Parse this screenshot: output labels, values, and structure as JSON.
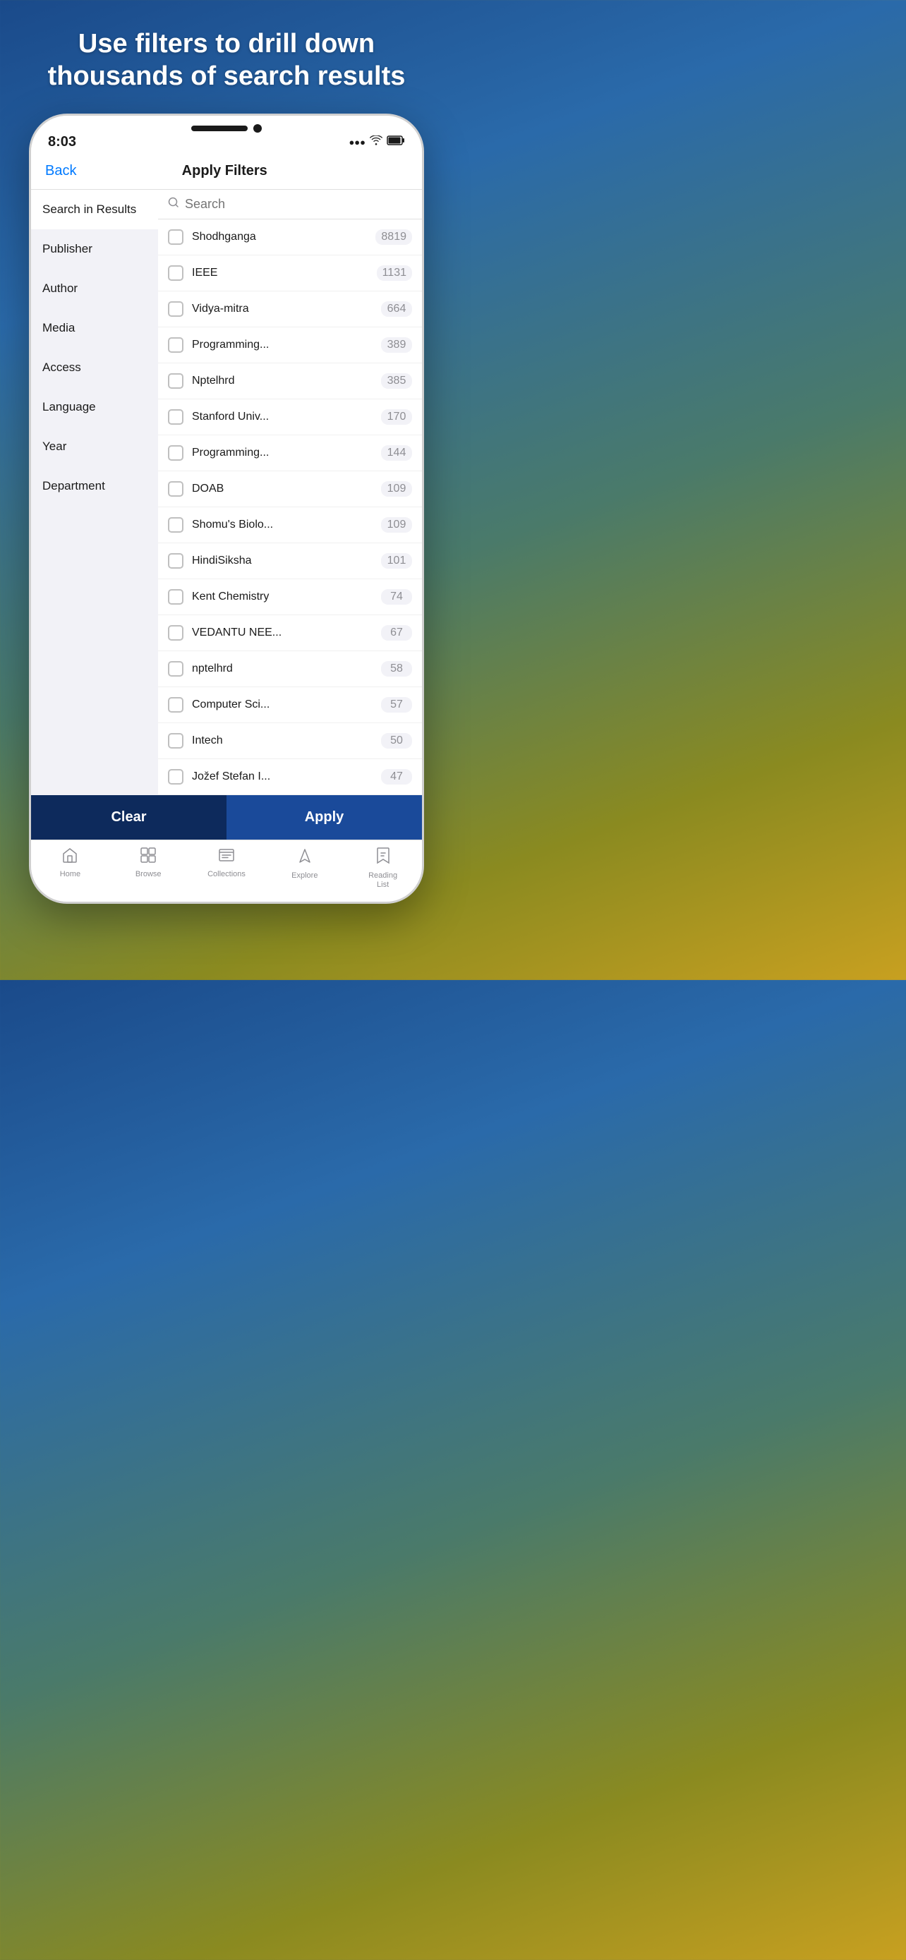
{
  "headline": "Use filters to drill down thousands of search results",
  "status": {
    "time": "8:03",
    "wifi": "wifi",
    "battery": "battery"
  },
  "nav": {
    "back_label": "Back",
    "title": "Apply Filters"
  },
  "sidebar": {
    "items": [
      {
        "id": "search-in-results",
        "label": "Search in Results",
        "active": true
      },
      {
        "id": "publisher",
        "label": "Publisher",
        "active": false
      },
      {
        "id": "author",
        "label": "Author",
        "active": false
      },
      {
        "id": "media",
        "label": "Media",
        "active": false
      },
      {
        "id": "access",
        "label": "Access",
        "active": false
      },
      {
        "id": "language",
        "label": "Language",
        "active": false
      },
      {
        "id": "year",
        "label": "Year",
        "active": false
      },
      {
        "id": "department",
        "label": "Department",
        "active": false
      }
    ]
  },
  "search": {
    "placeholder": "Search"
  },
  "publishers": [
    {
      "name": "Shodhganga",
      "count": "8819"
    },
    {
      "name": "IEEE",
      "count": "1131"
    },
    {
      "name": "Vidya-mitra",
      "count": "664"
    },
    {
      "name": "Programming...",
      "count": "389"
    },
    {
      "name": "Nptelhrd",
      "count": "385"
    },
    {
      "name": "Stanford Univ...",
      "count": "170"
    },
    {
      "name": "Programming...",
      "count": "144"
    },
    {
      "name": "DOAB",
      "count": "109"
    },
    {
      "name": "Shomu's Biolo...",
      "count": "109"
    },
    {
      "name": "HindiSiksha",
      "count": "101"
    },
    {
      "name": "Kent Chemistry",
      "count": "74"
    },
    {
      "name": "VEDANTU NEE...",
      "count": "67"
    },
    {
      "name": "nptelhrd",
      "count": "58"
    },
    {
      "name": "Computer Sci...",
      "count": "57"
    },
    {
      "name": "Intech",
      "count": "50"
    },
    {
      "name": "Jožef Stefan I...",
      "count": "47"
    }
  ],
  "buttons": {
    "clear": "Clear",
    "apply": "Apply"
  },
  "tabs": [
    {
      "id": "home",
      "label": "Home",
      "icon": "home"
    },
    {
      "id": "browse",
      "label": "Browse",
      "icon": "browse"
    },
    {
      "id": "collections",
      "label": "Collections",
      "icon": "collections"
    },
    {
      "id": "explore",
      "label": "Explore",
      "icon": "explore"
    },
    {
      "id": "reading-list",
      "label": "Reading\nList",
      "icon": "reading-list"
    }
  ]
}
